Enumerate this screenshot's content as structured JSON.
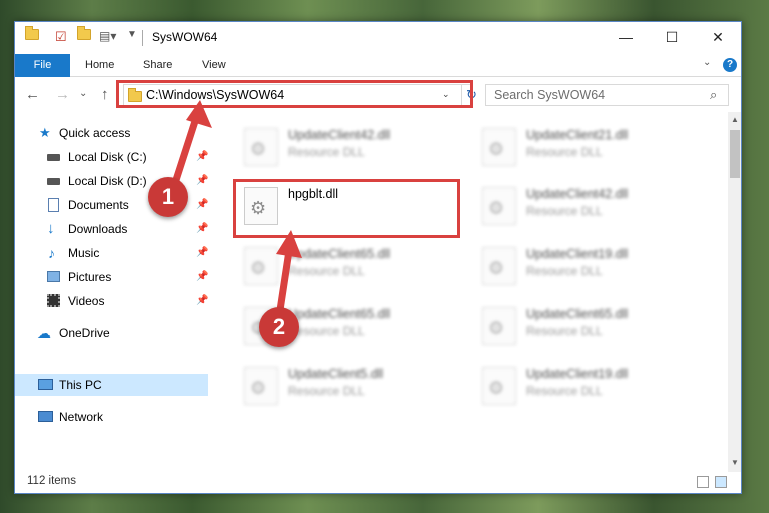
{
  "window": {
    "title": "SysWOW64",
    "controls": {
      "minimize": "—",
      "maximize": "☐",
      "close": "✕"
    }
  },
  "ribbon": {
    "file_label": "File",
    "tabs": [
      "Home",
      "Share",
      "View"
    ],
    "help_glyph": "?",
    "expand_glyph": "⌄"
  },
  "nav": {
    "back": "←",
    "forward": "→",
    "recent": "⌄",
    "up": "↑",
    "address": "C:\\Windows\\SysWOW64",
    "search_placeholder": "Search SysWOW64",
    "refresh_glyph": "↻",
    "search_glyph": "⌕",
    "address_dropdown": "⌄"
  },
  "sidebar": {
    "items": [
      {
        "label": "Quick access",
        "icon": "star-icon",
        "pinned": false
      },
      {
        "label": "Local Disk (C:)",
        "icon": "drive-icon",
        "pinned": true
      },
      {
        "label": "Local Disk (D:)",
        "icon": "drive-icon",
        "pinned": true
      },
      {
        "label": "Documents",
        "icon": "documents-icon",
        "pinned": true
      },
      {
        "label": "Downloads",
        "icon": "downloads-icon",
        "pinned": true
      },
      {
        "label": "Music",
        "icon": "music-icon",
        "pinned": true
      },
      {
        "label": "Pictures",
        "icon": "pictures-icon",
        "pinned": true
      },
      {
        "label": "Videos",
        "icon": "videos-icon",
        "pinned": true
      },
      {
        "label": "OneDrive",
        "icon": "cloud-icon",
        "pinned": false
      },
      {
        "label": "This PC",
        "icon": "computer-icon",
        "pinned": false,
        "selected": true
      },
      {
        "label": "Network",
        "icon": "network-icon",
        "pinned": false
      }
    ],
    "pin_glyph": "📌"
  },
  "files": [
    {
      "name": "UpdateClient42.dll",
      "type": "Resource DLL",
      "blurred": true
    },
    {
      "name": "UpdateClient21.dll",
      "type": "Resource DLL",
      "blurred": true
    },
    {
      "name": "hpgblt.dll",
      "type": "",
      "blurred": false
    },
    {
      "name": "UpdateClient42.dll",
      "type": "Resource DLL",
      "blurred": true
    },
    {
      "name": "UpdateClient65.dll",
      "type": "Resource DLL",
      "blurred": true
    },
    {
      "name": "UpdateClient19.dll",
      "type": "Resource DLL",
      "blurred": true
    },
    {
      "name": "UpdateClient65.dll",
      "type": "Resource DLL",
      "blurred": true
    },
    {
      "name": "UpdateClient65.dll",
      "type": "Resource DLL",
      "blurred": true
    },
    {
      "name": "UpdateClient5.dll",
      "type": "Resource DLL",
      "blurred": true
    },
    {
      "name": "UpdateClient19.dll",
      "type": "Resource DLL",
      "blurred": true
    }
  ],
  "status": {
    "items": "112 items"
  },
  "annotations": [
    {
      "number": "1",
      "color": "#c93937"
    },
    {
      "number": "2",
      "color": "#c93937"
    }
  ]
}
